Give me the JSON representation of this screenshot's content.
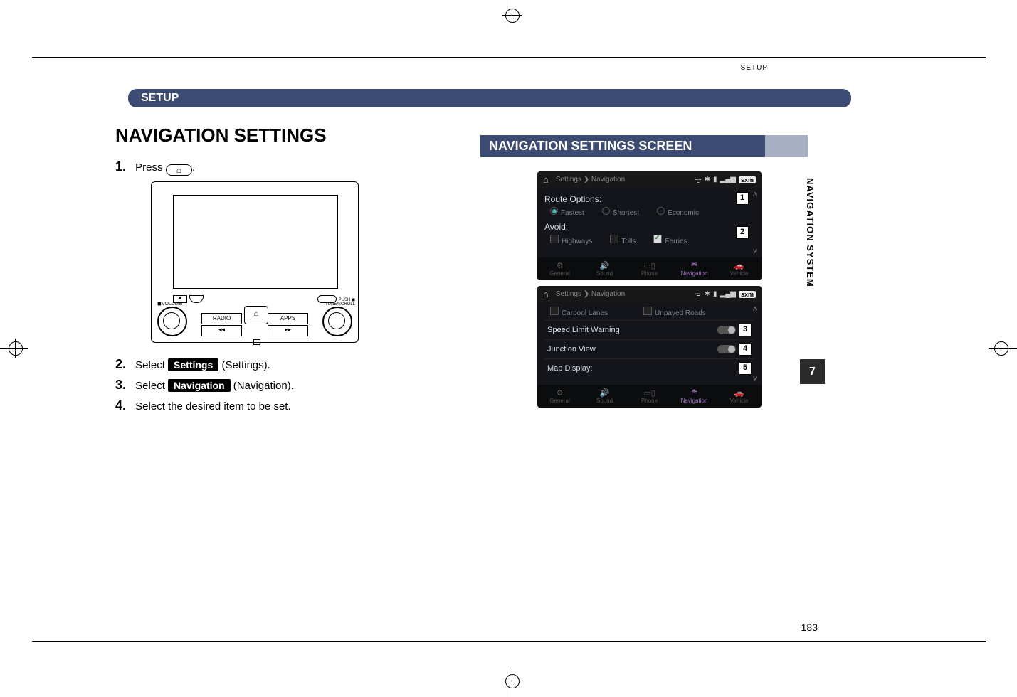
{
  "header": {
    "running_head": "SETUP",
    "pill": "SETUP"
  },
  "left": {
    "title": "NAVIGATION SETTINGS",
    "step1_prefix": "Press",
    "step1_suffix": ".",
    "home_icon": "⌂",
    "radio": {
      "volume_label": "VOLUME",
      "tune_label": "TUNE/SCROLL",
      "radio_btn": "RADIO",
      "apps_btn": "APPS",
      "prev_btn": "◂◂",
      "next_btn": "▸▸",
      "eject_btn": "▲"
    },
    "step2_prefix": "Select",
    "step2_btn": "Settings",
    "step2_paren": "(Settings).",
    "step3_prefix": "Select",
    "step3_btn": "Navigation",
    "step3_paren": "(Navigation).",
    "step4": "Select the desired item to be set."
  },
  "right": {
    "section_title": "NAVIGATION SETTINGS SCREEN",
    "shot1": {
      "breadcrumb": "Settings ❯ Navigation",
      "sxm": "sxm",
      "route_options": "Route Options:",
      "fastest": "Fastest",
      "shortest": "Shortest",
      "economic": "Economic",
      "avoid": "Avoid:",
      "highways": "Highways",
      "tolls": "Tolls",
      "ferries": "Ferries",
      "tab_general": "General",
      "tab_sound": "Sound",
      "tab_phone": "Phone",
      "tab_nav": "Navigation",
      "tab_vehicle": "Vehicle"
    },
    "shot2": {
      "breadcrumb": "Settings ❯ Navigation",
      "sxm": "sxm",
      "carpool": "Carpool Lanes",
      "unpaved": "Unpaved Roads",
      "speed": "Speed Limit Warning",
      "junction": "Junction View",
      "map": "Map Display:",
      "tab_general": "General",
      "tab_sound": "Sound",
      "tab_phone": "Phone",
      "tab_nav": "Navigation",
      "tab_vehicle": "Vehicle"
    },
    "markers": {
      "m1": "1",
      "m2": "2",
      "m3": "3",
      "m4": "4",
      "m5": "5"
    }
  },
  "side": {
    "label": "NAVIGATION SYSTEM",
    "thumb": "7",
    "pagenum": "183"
  }
}
